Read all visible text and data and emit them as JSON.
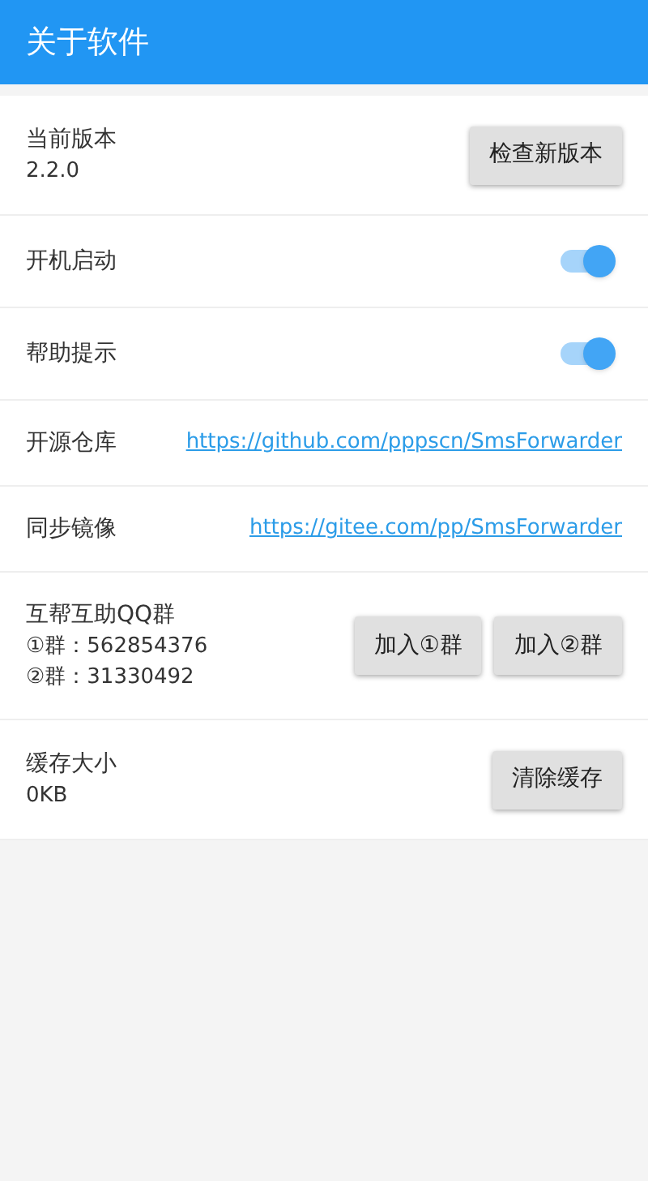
{
  "app_bar": {
    "title": "关于软件"
  },
  "rows": [
    {
      "kind": "info",
      "label": "当前版本",
      "lines": [
        "2.2.0"
      ],
      "buttons": [
        "检查新版本"
      ]
    },
    {
      "kind": "switch",
      "label": "开机启动",
      "on": true
    },
    {
      "kind": "switch",
      "label": "帮助提示",
      "on": true
    },
    {
      "kind": "link",
      "label": "开源仓库",
      "link": "https://github.com/pppscn/SmsForwarder"
    },
    {
      "kind": "link",
      "label": "同步镜像",
      "link": "https://gitee.com/pp/SmsForwarder"
    },
    {
      "kind": "info",
      "label": "互帮互助QQ群",
      "lines": [
        "①群：562854376",
        "②群：31330492"
      ],
      "buttons": [
        "加入①群",
        "加入②群"
      ]
    },
    {
      "kind": "info",
      "label": "缓存大小",
      "lines": [
        "0KB"
      ],
      "buttons": [
        "清除缓存"
      ]
    }
  ]
}
